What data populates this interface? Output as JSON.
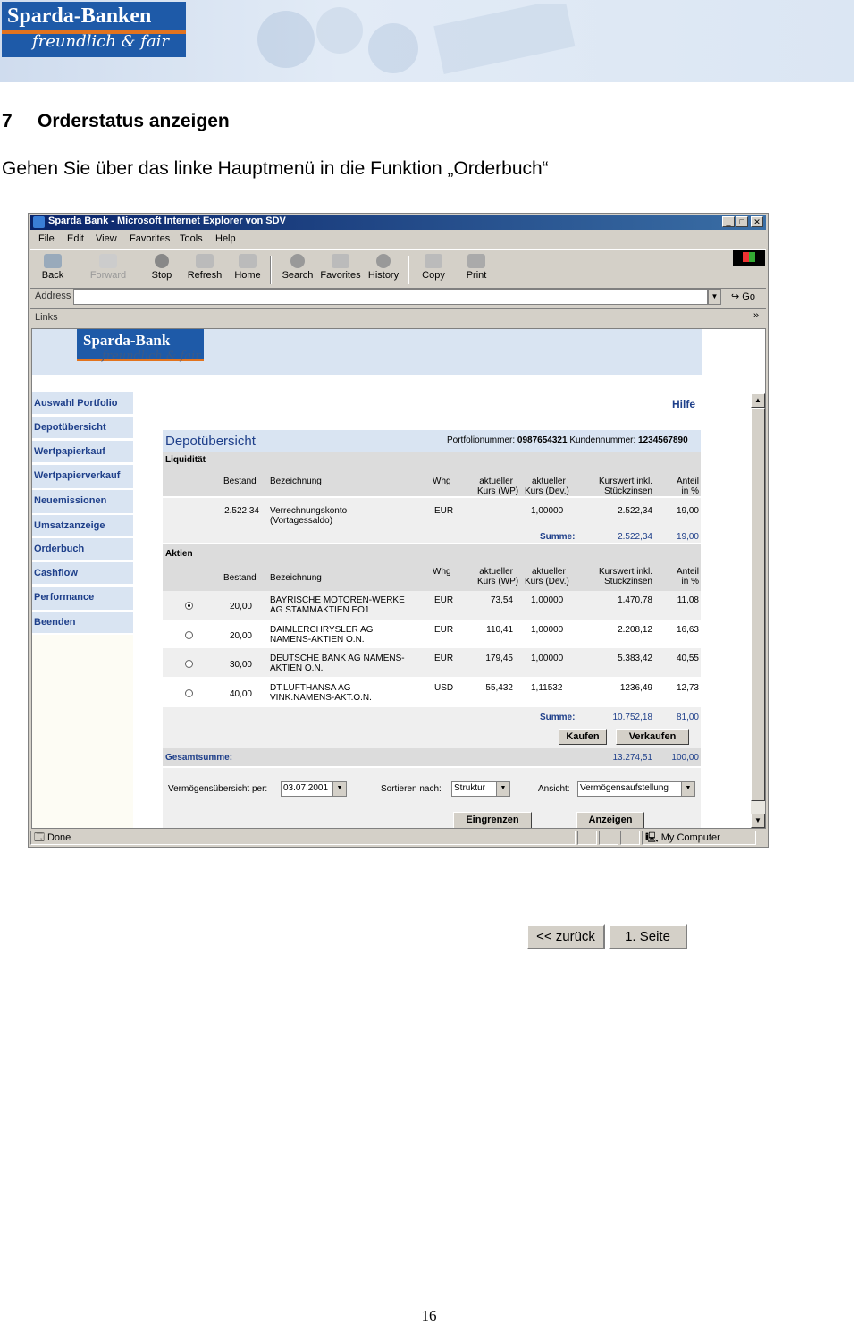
{
  "banner": {
    "brand": "Sparda-Banken",
    "slogan": "freundlich & fair"
  },
  "chapter": {
    "number": "7",
    "title": "Orderstatus anzeigen"
  },
  "intro": "Gehen Sie über das linke Hauptmenü in die Funktion „Orderbuch“",
  "browser": {
    "title": "Sparda Bank - Microsoft Internet Explorer von SDV",
    "menu": [
      "File",
      "Edit",
      "View",
      "Favorites",
      "Tools",
      "Help"
    ],
    "toolbar": [
      "Back",
      "Forward",
      "Stop",
      "Refresh",
      "Home",
      "Search",
      "Favorites",
      "History",
      "Copy",
      "Print"
    ],
    "address_label": "Address",
    "go_label": "Go",
    "links_label": "Links",
    "links_more": "»",
    "status_text": "Done",
    "zone": "My Computer"
  },
  "site": {
    "brand": "Sparda-Bank",
    "slogan": "freundlich & fair",
    "help": "Hilfe",
    "nav": [
      "Auswahl Portfolio",
      "Depotübersicht",
      "Wertpapierkauf",
      "Wertpapierverkauf",
      "Neuemissionen",
      "Umsatzanzeige",
      "Orderbuch",
      "Cashflow",
      "Performance",
      "Beenden"
    ]
  },
  "depot": {
    "title": "Depotübersicht",
    "portfolio_label": "Portfolionummer:",
    "portfolio_no": "0987654321",
    "customer_label": "Kundennummer:",
    "customer_no": "1234567890",
    "liquidity_label": "Liquidität",
    "shares_label": "Aktien",
    "columns": {
      "bestand": "Bestand",
      "bezeichnung": "Bezeichnung",
      "whg": "Whg",
      "kurs_wp_1": "aktueller",
      "kurs_wp_2": "Kurs (WP)",
      "kurs_dev_1": "aktueller",
      "kurs_dev_2": "Kurs (Dev.)",
      "kurswert_1": "Kurswert inkl.",
      "kurswert_2": "Stückzinsen",
      "anteil_1": "Anteil",
      "anteil_2": "in %"
    },
    "liquidity_row": {
      "bestand": "2.522,34",
      "name1": "Verrechnungskonto",
      "name2": "(Vortagessaldo)",
      "whg": "EUR",
      "kurs_dev": "1,00000",
      "kurswert": "2.522,34",
      "anteil": "19,00"
    },
    "liquidity_sum": {
      "label": "Summe:",
      "kurswert": "2.522,34",
      "anteil": "19,00"
    },
    "shares": [
      {
        "bestand": "20,00",
        "name1": "BAYRISCHE MOTOREN-WERKE",
        "name2": "AG STAMMAKTIEN EO1",
        "whg": "EUR",
        "kurs_wp": "73,54",
        "kurs_dev": "1,00000",
        "kurswert": "1.470,78",
        "anteil": "11,08"
      },
      {
        "bestand": "20,00",
        "name1": "DAIMLERCHRYSLER AG",
        "name2": "NAMENS-AKTIEN O.N.",
        "whg": "EUR",
        "kurs_wp": "110,41",
        "kurs_dev": "1,00000",
        "kurswert": "2.208,12",
        "anteil": "16,63"
      },
      {
        "bestand": "30,00",
        "name1": "DEUTSCHE BANK AG NAMENS-",
        "name2": "AKTIEN O.N.",
        "whg": "EUR",
        "kurs_wp": "179,45",
        "kurs_dev": "1,00000",
        "kurswert": "5.383,42",
        "anteil": "40,55"
      },
      {
        "bestand": "40,00",
        "name1": "DT.LUFTHANSA AG",
        "name2": "VINK.NAMENS-AKT.O.N.",
        "whg": "USD",
        "kurs_wp": "55,432",
        "kurs_dev": "1,11532",
        "kurswert": "1236,49",
        "anteil": "12,73"
      }
    ],
    "shares_sum": {
      "label": "Summe:",
      "kurswert": "10.752,18",
      "anteil": "81,00"
    },
    "buy_button": "Kaufen",
    "sell_button": "Verkaufen",
    "total": {
      "label": "Gesamtsumme:",
      "kurswert": "13.274,51",
      "anteil": "100,00"
    },
    "filters": {
      "date_label": "Vermögensübersicht per:",
      "date_value": "03.07.2001",
      "sort_label": "Sortieren nach:",
      "sort_value": "Struktur",
      "view_label": "Ansicht:",
      "view_value": "Vermögensaufstellung"
    },
    "restrict_button": "Eingrenzen",
    "show_button": "Anzeigen"
  },
  "pager": {
    "back": "<< zurück",
    "first": "1. Seite"
  },
  "page_number": "16"
}
